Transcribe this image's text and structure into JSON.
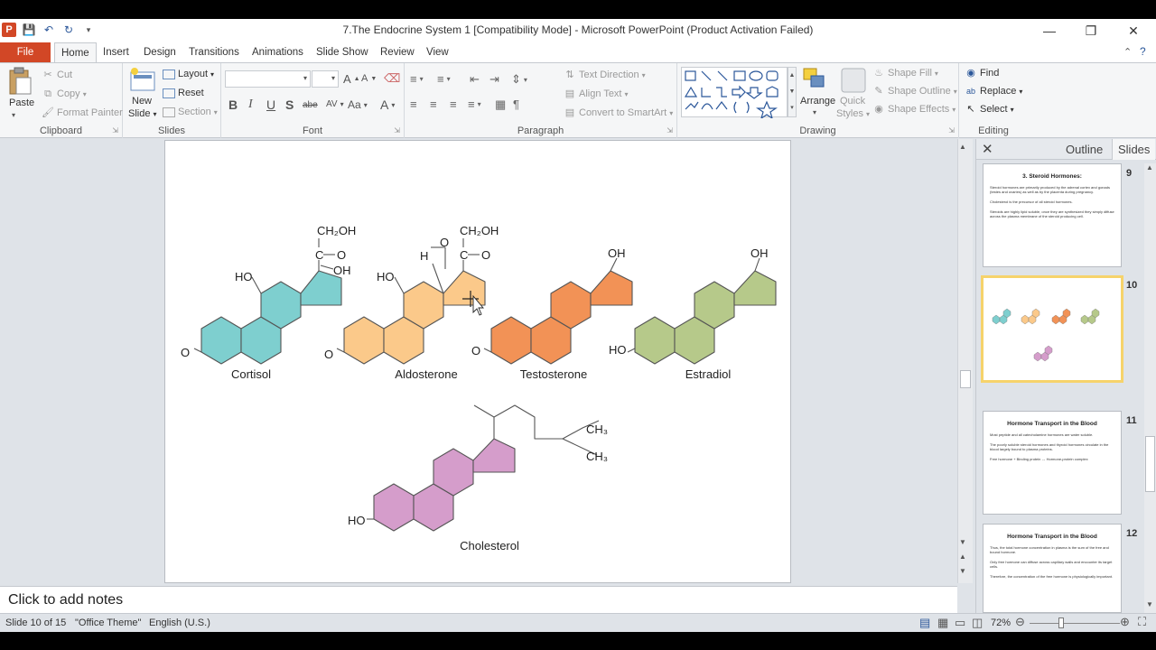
{
  "window": {
    "title": "7.The Endocrine System 1 [Compatibility Mode]  -  Microsoft PowerPoint (Product Activation Failed)",
    "app_icon": "P"
  },
  "tabs": [
    "File",
    "Home",
    "Insert",
    "Design",
    "Transitions",
    "Animations",
    "Slide Show",
    "Review",
    "View"
  ],
  "ribbon": {
    "clipboard": {
      "label": "Clipboard",
      "paste": "Paste",
      "cut": "Cut",
      "copy": "Copy",
      "format_painter": "Format Painter"
    },
    "slides": {
      "label": "Slides",
      "new_slide_1": "New",
      "new_slide_2": "Slide",
      "layout": "Layout",
      "reset": "Reset",
      "section": "Section"
    },
    "font": {
      "label": "Font",
      "bold": "B",
      "italic": "I",
      "underline": "U",
      "shadow": "S",
      "strike": "abe",
      "spacing": "AV",
      "case": "Aa",
      "color": "A"
    },
    "paragraph": {
      "label": "Paragraph",
      "text_direction": "Text Direction",
      "align_text": "Align Text",
      "smartart": "Convert to SmartArt"
    },
    "drawing": {
      "label": "Drawing",
      "arrange": "Arrange",
      "quick_styles_1": "Quick",
      "quick_styles_2": "Styles",
      "shape_fill": "Shape Fill",
      "shape_outline": "Shape Outline",
      "shape_effects": "Shape Effects"
    },
    "editing": {
      "label": "Editing",
      "find": "Find",
      "replace": "Replace",
      "select": "Select"
    }
  },
  "slide": {
    "labels": {
      "cortisol": "Cortisol",
      "aldosterone": "Aldosterone",
      "testosterone": "Testosterone",
      "estradiol": "Estradiol",
      "cholesterol": "Cholesterol",
      "ch2oh": "CH₂OH",
      "c": "C",
      "o": "O",
      "oh": "OH",
      "ho": "HO",
      "h": "H",
      "ch3": "CH₃"
    },
    "colors": {
      "cortisol": "#7ecfcf",
      "aldosterone": "#fbc98a",
      "testosterone": "#f29256",
      "estradiol": "#b6c98a",
      "cholesterol": "#d59dcb"
    }
  },
  "notes": {
    "placeholder": "Click to add notes"
  },
  "panel": {
    "outline_tab": "Outline",
    "slides_tab": "Slides",
    "thumbnails": [
      {
        "num": "9",
        "title": "3. Steroid Hormones:",
        "lines": [
          "Steroid hormones are primarily produced by the adrenal cortex and gonads (testes and ovaries) as well as by the placenta during pregnancy.",
          "Cholesterol is the precursor of all steroid hormones.",
          "Steroids are highly lipid soluble, once they are synthesized they simply diffuse across the plasma membrane of the steroid producing cell."
        ]
      },
      {
        "num": "10",
        "title": "",
        "lines": []
      },
      {
        "num": "11",
        "title": "Hormone Transport in the Blood",
        "lines": [
          "Most peptide and all catecholamine hormones are water soluble.",
          "The poorly soluble steroid hormones and thyroid hormones circulate in the blood largely bound to plasma proteins.",
          "Free hormone + Binding protein ↔ Hormone-protein complex"
        ]
      },
      {
        "num": "12",
        "title": "Hormone Transport in the Blood",
        "lines": [
          "Thus, the total hormone concentration in plasma is the sum of the free and bound hormone.",
          "Only free hormone can diffuse across capillary walls and encounter its target cells.",
          "Therefore, the concentration of the free hormone is physiologically important."
        ]
      }
    ]
  },
  "status": {
    "slide_info": "Slide 10 of 15",
    "theme": "\"Office Theme\"",
    "language": "English (U.S.)",
    "zoom": "72%"
  }
}
